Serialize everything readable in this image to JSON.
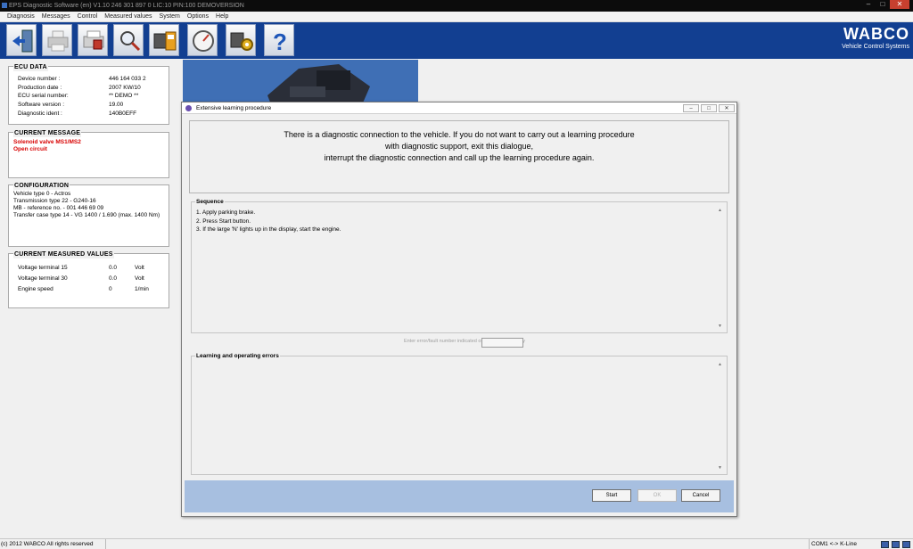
{
  "window": {
    "title": "EPS Diagnostic Software (en) V1.10  246 301 897  0  LIC:10 PIN:100 DEMOVERSION"
  },
  "menu": [
    "Diagnosis",
    "Messages",
    "Control",
    "Measured values",
    "System",
    "Options",
    "Help"
  ],
  "toolbar": {
    "buttons": [
      "exit-icon",
      "print-icon",
      "printer-ecu-icon",
      "search-icon",
      "ecu-device-icon",
      "gauge-icon",
      "settings-icon",
      "help-icon"
    ],
    "help_glyph": "?",
    "brand": "WABCO",
    "brand_sub": "Vehicle Control Systems"
  },
  "ecu_data": {
    "title": "ECU DATA",
    "rows": [
      {
        "label": "Device number :",
        "value": "446 164 033 2"
      },
      {
        "label": "Production date :",
        "value": "2007 KW/10"
      },
      {
        "label": "ECU serial number:",
        "value": "** DEMO **"
      },
      {
        "label": "Software version :",
        "value": "19.00"
      },
      {
        "label": "Diagnostic ident :",
        "value": "140B0EFF"
      }
    ]
  },
  "current_message": {
    "title": "CURRENT MESSAGE",
    "lines": [
      "Solenoid valve MS1/MS2",
      "Open circuit"
    ]
  },
  "configuration": {
    "title": "CONFIGURATION",
    "lines": [
      "Vehicle type 0 - Actros",
      "Transmission type  22 - G240-16",
      "MB - reference no. - 001 446 69 09",
      "Transfer case type  14 - VG 1400 / 1.690 (max. 1400 Nm)"
    ]
  },
  "measured_values": {
    "title": "CURRENT MEASURED VALUES",
    "rows": [
      {
        "label": "Voltage terminal 15",
        "value": "0.0",
        "unit": "Volt"
      },
      {
        "label": "Voltage terminal 30",
        "value": "0.0",
        "unit": "Volt"
      },
      {
        "label": "Engine speed",
        "value": "0",
        "unit": "1/min"
      }
    ]
  },
  "dialog": {
    "title": "Extensive learning procedure",
    "message": [
      "There is a diagnostic connection to the vehicle. If you do not want to carry out a learning procedure",
      "with diagnostic support, exit this dialogue,",
      "interrupt the diagnostic connection and call up the learning procedure again."
    ],
    "sequence_title": "Sequence",
    "sequence": [
      "1. Apply parking brake.",
      "2. Press Start button.",
      "3. If the large 'N' lights up in the display, start the engine."
    ],
    "error_prompt": "Enter error/fault number indicated on the vehicle display",
    "error_value": "",
    "errors_title": "Learning and operating errors",
    "buttons": {
      "start": "Start",
      "ok": "OK",
      "cancel": "Cancel"
    }
  },
  "status": {
    "copyright": "(c) 2012 WABCO All rights reserved",
    "port": "COM1 <-> K-Line"
  },
  "colors": {
    "toolbar_bg": "#123f91",
    "message_red": "#d80000",
    "button_bar": "#a7bfe0"
  }
}
